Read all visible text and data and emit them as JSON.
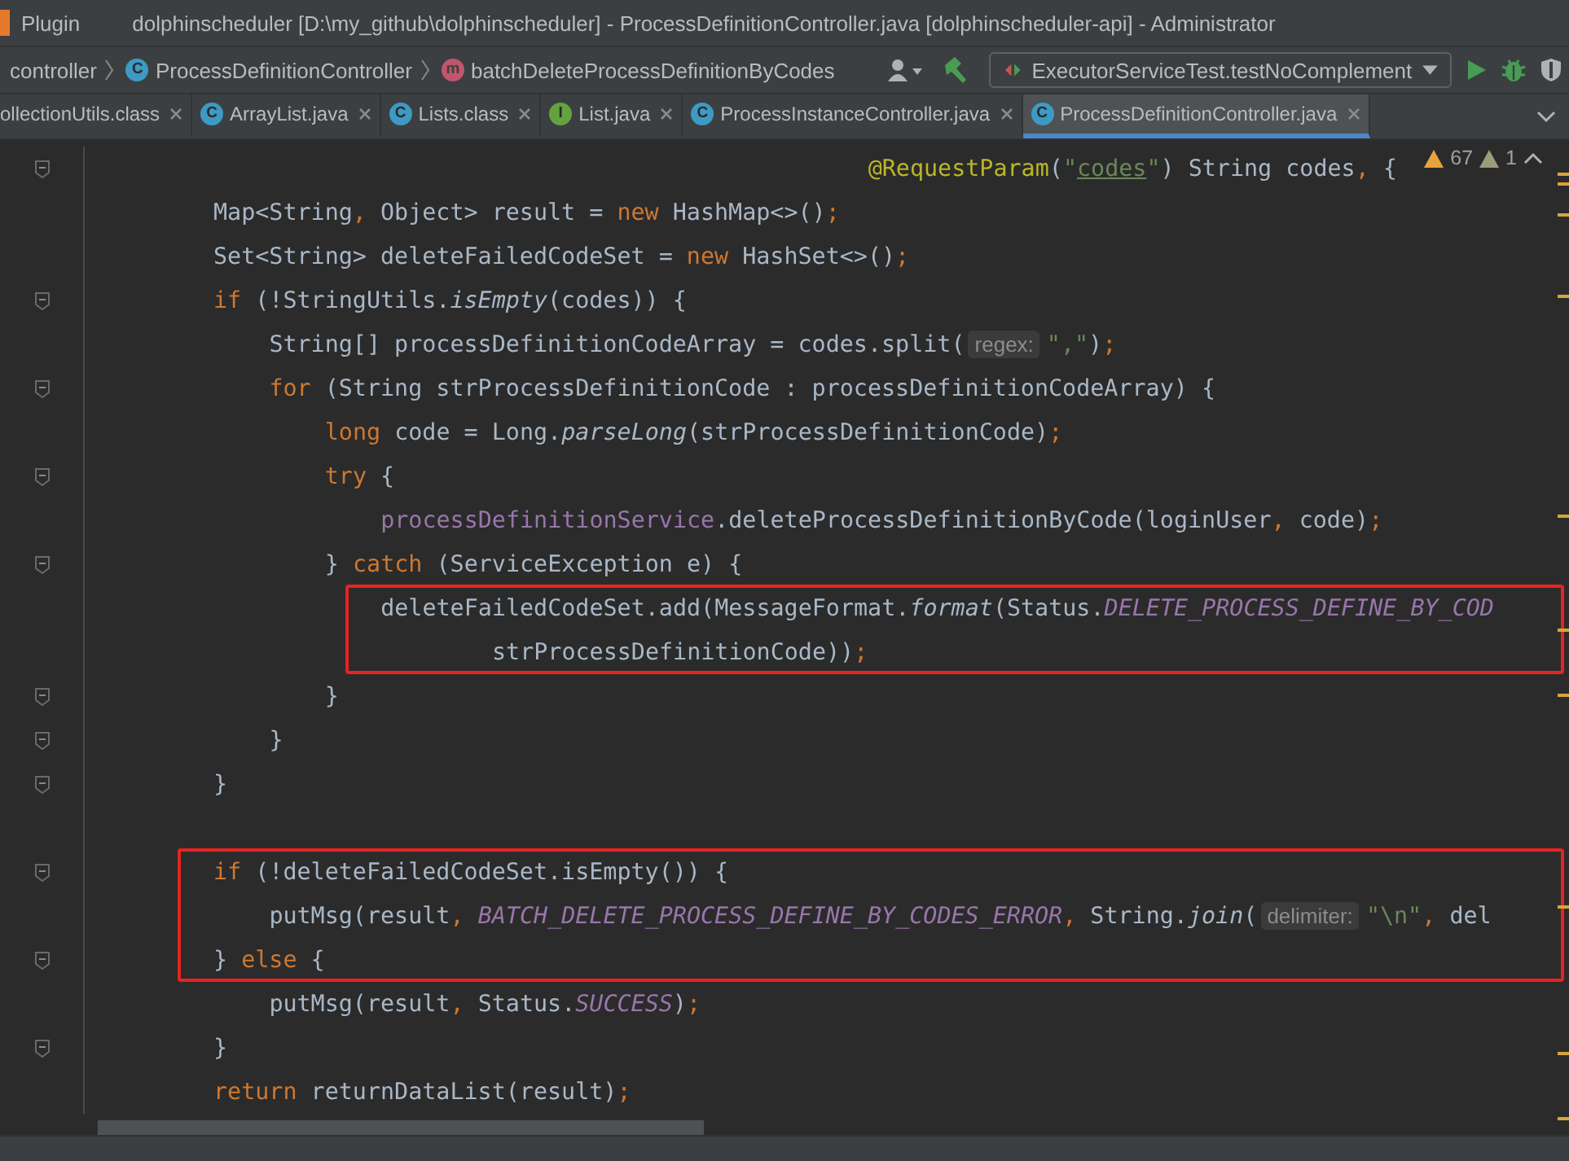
{
  "window": {
    "menu": [
      {
        "label": "Plugin"
      }
    ],
    "title": "dolphinscheduler [D:\\my_github\\dolphinscheduler] - ProcessDefinitionController.java [dolphinscheduler-api] - Administrator"
  },
  "breadcrumbs": [
    {
      "label": "controller",
      "kind": "folder"
    },
    {
      "label": "ProcessDefinitionController",
      "kind": "class",
      "icon_text": "C"
    },
    {
      "label": "batchDeleteProcessDefinitionByCodes",
      "kind": "method",
      "icon_text": "m"
    }
  ],
  "run_config": {
    "label": "ExecutorServiceTest.testNoComplement"
  },
  "tabs": [
    {
      "label": "ollectionUtils.class",
      "selected": false
    },
    {
      "label": "ArrayList.java",
      "kind": "class",
      "icon_text": "C",
      "selected": false
    },
    {
      "label": "Lists.class",
      "kind": "class",
      "icon_text": "C",
      "selected": false
    },
    {
      "label": "List.java",
      "kind": "interface",
      "icon_text": "I",
      "selected": false
    },
    {
      "label": "ProcessInstanceController.java",
      "kind": "class",
      "icon_text": "C",
      "selected": false
    },
    {
      "label": "ProcessDefinitionController.java",
      "kind": "class",
      "icon_text": "C",
      "selected": true
    }
  ],
  "inspections": {
    "warnings": "67",
    "weak_warnings": "1"
  },
  "code": [
    {
      "kind": "aligned",
      "fold": true,
      "boxed": false,
      "segments": [
        {
          "kind": "code",
          "tokens": [
            {
              "text": "@RequestParam",
              "kind": "annotation"
            },
            {
              "text": "(",
              "kind": "plain"
            },
            {
              "text": "\"",
              "kind": "string"
            },
            {
              "text": "codes",
              "kind": "link"
            },
            {
              "text": "\"",
              "kind": "string"
            },
            {
              "text": ") String codes",
              "kind": "plain"
            },
            {
              "text": ",",
              "kind": "keyword"
            },
            {
              "text": " {",
              "kind": "plain"
            }
          ]
        }
      ]
    },
    {
      "kind": "line",
      "fold": false,
      "boxed": false,
      "segments": [
        {
          "kind": "code",
          "tokens": [
            {
              "text": "Map<String",
              "kind": "plain"
            },
            {
              "text": ",",
              "kind": "keyword"
            },
            {
              "text": " Object> result = ",
              "kind": "plain"
            },
            {
              "text": "new",
              "kind": "keyword"
            },
            {
              "text": " HashMap<>()",
              "kind": "plain"
            },
            {
              "text": ";",
              "kind": "keyword"
            }
          ]
        }
      ]
    },
    {
      "kind": "line",
      "fold": false,
      "boxed": false,
      "segments": [
        {
          "kind": "code",
          "tokens": [
            {
              "text": "Set<String> deleteFailedCodeSet = ",
              "kind": "plain"
            },
            {
              "text": "new",
              "kind": "keyword"
            },
            {
              "text": " HashSet<>()",
              "kind": "plain"
            },
            {
              "text": ";",
              "kind": "keyword"
            }
          ]
        }
      ]
    },
    {
      "kind": "line",
      "fold": true,
      "boxed": false,
      "segments": [
        {
          "kind": "code",
          "tokens": [
            {
              "text": "if",
              "kind": "keyword"
            },
            {
              "text": " (!StringUtils.",
              "kind": "plain"
            },
            {
              "text": "isEmpty",
              "kind": "static"
            },
            {
              "text": "(codes)) {",
              "kind": "plain"
            }
          ]
        }
      ],
      "children": [
        {
          "kind": "line",
          "fold": false,
          "boxed": false,
          "segments": [
            {
              "kind": "code",
              "tokens": [
                {
                  "text": "String[] processDefinitionCodeArray = codes.split(",
                  "kind": "plain"
                }
              ]
            },
            {
              "kind": "hint",
              "text": "regex:"
            },
            {
              "kind": "code",
              "tokens": [
                {
                  "text": "\",\"",
                  "kind": "string"
                },
                {
                  "text": ")",
                  "kind": "plain"
                },
                {
                  "text": ";",
                  "kind": "keyword"
                }
              ]
            }
          ]
        },
        {
          "kind": "line",
          "fold": true,
          "boxed": false,
          "segments": [
            {
              "kind": "code",
              "tokens": [
                {
                  "text": "for",
                  "kind": "keyword"
                },
                {
                  "text": " (String strProcessDefinitionCode : processDefinitionCodeArray) {",
                  "kind": "plain"
                }
              ]
            }
          ],
          "children": [
            {
              "kind": "line",
              "fold": false,
              "boxed": false,
              "segments": [
                {
                  "kind": "code",
                  "tokens": [
                    {
                      "text": "long",
                      "kind": "keyword"
                    },
                    {
                      "text": " code = Long.",
                      "kind": "plain"
                    },
                    {
                      "text": "parseLong",
                      "kind": "static"
                    },
                    {
                      "text": "(strProcessDefinitionCode)",
                      "kind": "plain"
                    },
                    {
                      "text": ";",
                      "kind": "keyword"
                    }
                  ]
                }
              ]
            },
            {
              "kind": "line",
              "fold": true,
              "boxed": false,
              "segments": [
                {
                  "kind": "code",
                  "tokens": [
                    {
                      "text": "try",
                      "kind": "keyword"
                    },
                    {
                      "text": " {",
                      "kind": "plain"
                    }
                  ]
                }
              ],
              "children": [
                {
                  "kind": "line",
                  "fold": false,
                  "boxed": false,
                  "segments": [
                    {
                      "kind": "code",
                      "tokens": [
                        {
                          "text": "processDefinitionService",
                          "kind": "field"
                        },
                        {
                          "text": ".deleteProcessDefinitionByCode(loginUser",
                          "kind": "plain"
                        },
                        {
                          "text": ",",
                          "kind": "keyword"
                        },
                        {
                          "text": " code)",
                          "kind": "plain"
                        },
                        {
                          "text": ";",
                          "kind": "keyword"
                        }
                      ]
                    }
                  ]
                }
              ]
            },
            {
              "kind": "line",
              "fold": true,
              "boxed": false,
              "segments": [
                {
                  "kind": "code",
                  "tokens": [
                    {
                      "text": "} ",
                      "kind": "plain"
                    },
                    {
                      "text": "catch",
                      "kind": "keyword"
                    },
                    {
                      "text": " (ServiceException e) {",
                      "kind": "plain"
                    }
                  ]
                }
              ],
              "children": [
                {
                  "kind": "line",
                  "fold": false,
                  "boxed": true,
                  "segments": [
                    {
                      "kind": "code",
                      "tokens": [
                        {
                          "text": "deleteFailedCodeSet.add(MessageFormat.",
                          "kind": "plain"
                        },
                        {
                          "text": "format",
                          "kind": "static"
                        },
                        {
                          "text": "(Status.",
                          "kind": "plain"
                        },
                        {
                          "text": "DELETE_PROCESS_DEFINE_BY_COD",
                          "kind": "constant"
                        }
                      ]
                    }
                  ]
                },
                {
                  "kind": "continuation",
                  "fold": false,
                  "boxed": true,
                  "segments": [
                    {
                      "kind": "code",
                      "tokens": [
                        {
                          "text": "strProcessDefinitionCode))",
                          "kind": "plain"
                        },
                        {
                          "text": ";",
                          "kind": "keyword"
                        }
                      ]
                    }
                  ]
                }
              ]
            },
            {
              "kind": "line",
              "fold": true,
              "boxed": false,
              "segments": [
                {
                  "kind": "code",
                  "tokens": [
                    {
                      "text": "}",
                      "kind": "plain"
                    }
                  ]
                }
              ]
            }
          ]
        },
        {
          "kind": "line",
          "fold": true,
          "boxed": false,
          "segments": [
            {
              "kind": "code",
              "tokens": [
                {
                  "text": "}",
                  "kind": "plain"
                }
              ]
            }
          ]
        }
      ]
    },
    {
      "kind": "line",
      "fold": true,
      "boxed": false,
      "segments": [
        {
          "kind": "code",
          "tokens": [
            {
              "text": "}",
              "kind": "plain"
            }
          ]
        }
      ]
    },
    {
      "kind": "blank"
    },
    {
      "kind": "line",
      "fold": true,
      "boxed": true,
      "segments": [
        {
          "kind": "code",
          "tokens": [
            {
              "text": "if",
              "kind": "keyword"
            },
            {
              "text": " (!deleteFailedCodeSet.isEmpty()) {",
              "kind": "plain"
            }
          ]
        }
      ],
      "children": [
        {
          "kind": "line",
          "fold": false,
          "boxed": true,
          "segments": [
            {
              "kind": "code",
              "tokens": [
                {
                  "text": "putMsg(result",
                  "kind": "plain"
                },
                {
                  "text": ", ",
                  "kind": "keyword"
                },
                {
                  "text": "BATCH_DELETE_PROCESS_DEFINE_BY_CODES_ERROR",
                  "kind": "constant"
                },
                {
                  "text": ",",
                  "kind": "keyword"
                },
                {
                  "text": " String.",
                  "kind": "plain"
                },
                {
                  "text": "join",
                  "kind": "static"
                },
                {
                  "text": "(",
                  "kind": "plain"
                }
              ]
            },
            {
              "kind": "hint",
              "text": "delimiter:"
            },
            {
              "kind": "code",
              "tokens": [
                {
                  "text": "\"\\n\"",
                  "kind": "string"
                },
                {
                  "text": ",",
                  "kind": "keyword"
                },
                {
                  "text": " del",
                  "kind": "plain"
                }
              ]
            }
          ]
        }
      ]
    },
    {
      "kind": "line",
      "fold": true,
      "boxed": true,
      "segments": [
        {
          "kind": "code",
          "tokens": [
            {
              "text": "} ",
              "kind": "plain"
            },
            {
              "text": "else",
              "kind": "keyword"
            },
            {
              "text": " {",
              "kind": "plain"
            }
          ]
        }
      ],
      "children": [
        {
          "kind": "line",
          "fold": false,
          "boxed": false,
          "segments": [
            {
              "kind": "code",
              "tokens": [
                {
                  "text": "putMsg(result",
                  "kind": "plain"
                },
                {
                  "text": ",",
                  "kind": "keyword"
                },
                {
                  "text": " Status.",
                  "kind": "plain"
                },
                {
                  "text": "SUCCESS",
                  "kind": "constant"
                },
                {
                  "text": ")",
                  "kind": "plain"
                },
                {
                  "text": ";",
                  "kind": "keyword"
                }
              ]
            }
          ]
        }
      ]
    },
    {
      "kind": "line",
      "fold": true,
      "boxed": false,
      "segments": [
        {
          "kind": "code",
          "tokens": [
            {
              "text": "}",
              "kind": "plain"
            }
          ]
        }
      ]
    },
    {
      "kind": "line",
      "fold": false,
      "boxed": false,
      "segments": [
        {
          "kind": "code",
          "tokens": [
            {
              "text": "return",
              "kind": "keyword"
            },
            {
              "text": " returnDataList(result)",
              "kind": "plain"
            },
            {
              "text": ";",
              "kind": "keyword"
            }
          ]
        }
      ]
    }
  ]
}
